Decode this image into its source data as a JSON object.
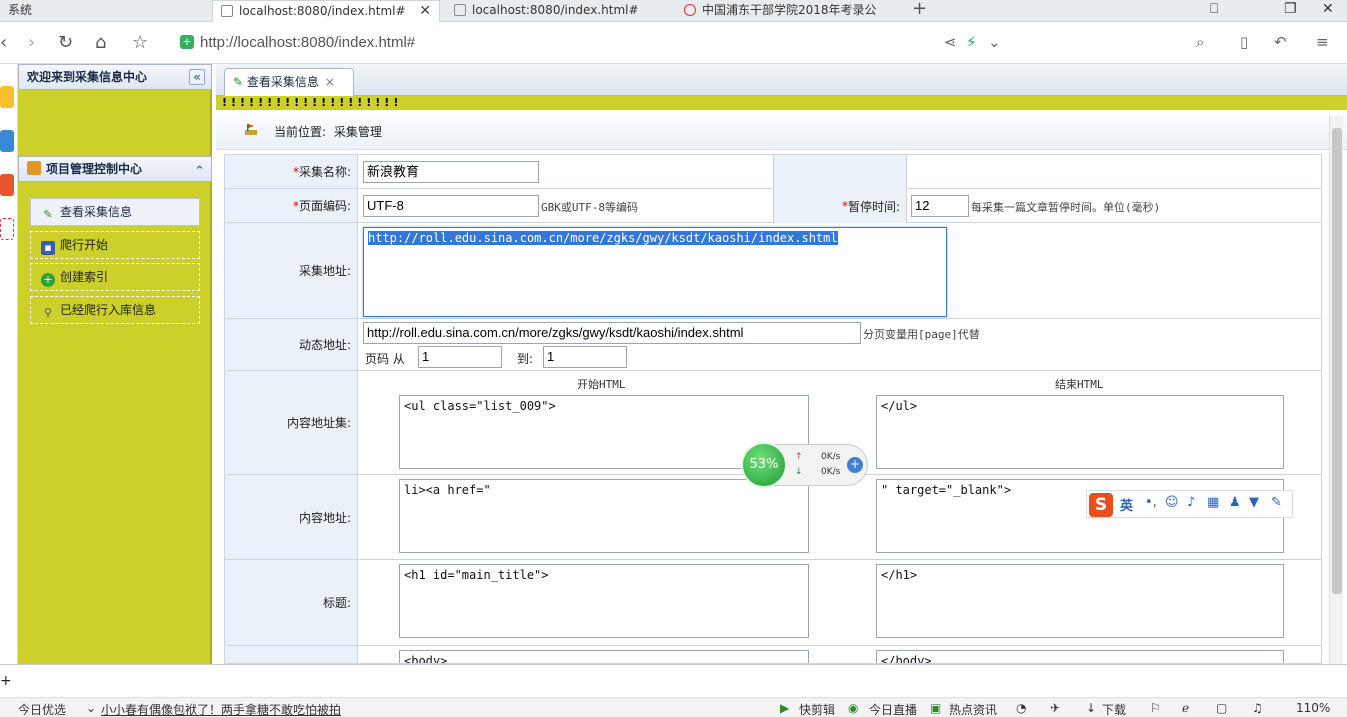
{
  "browser": {
    "tabs": [
      {
        "label": "系统",
        "active": false
      },
      {
        "label": "localhost:8080/index.html#",
        "active": true
      },
      {
        "label": "localhost:8080/index.html#",
        "active": false
      },
      {
        "label": "中国浦东干部学院2018年考录公",
        "active": false
      }
    ],
    "url": "http://localhost:8080/index.html#"
  },
  "sidebar": {
    "welcome": "欢迎来到采集信息中心",
    "section": "项目管理控制中心",
    "items": [
      {
        "label": "查看采集信息",
        "icon": "pencil-icon",
        "selected": true
      },
      {
        "label": "爬行开始",
        "icon": "save-icon",
        "selected": false
      },
      {
        "label": "创建索引",
        "icon": "plus-icon",
        "selected": false
      },
      {
        "label": "已经爬行入库信息",
        "icon": "search-icon",
        "selected": false
      }
    ]
  },
  "main": {
    "tab_label": "查看采集信息",
    "bang": "!!!!!!!!!!!!!!!!!!!!",
    "location_label": "当前位置:",
    "location_value": "采集管理"
  },
  "form": {
    "collect_name": {
      "label": "采集名称:",
      "value": "新浪教育"
    },
    "encoding": {
      "label": "页面编码:",
      "value": "UTF-8",
      "hint": "GBK或UTF-8等编码"
    },
    "pause": {
      "label": "暂停时间:",
      "value": "12",
      "hint": "每采集一篇文章暂停时间。单位(毫秒)"
    },
    "collect_url": {
      "label": "采集地址:",
      "value": "http://roll.edu.sina.com.cn/more/zgks/gwy/ksdt/kaoshi/index.shtml"
    },
    "dynamic_url": {
      "label": "动态地址:",
      "value": "http://roll.edu.sina.com.cn/more/zgks/gwy/ksdt/kaoshi/index.shtml",
      "hint": "分页变量用[page]代替"
    },
    "page_range": {
      "label_from": "页码 从",
      "from": "1",
      "label_to": "到:",
      "to": "1"
    },
    "start_html_header": "开始HTML",
    "end_html_header": "结束HTML",
    "content_url_set": {
      "label": "内容地址集:",
      "start": "<ul class=\"list_009\">",
      "end": "</ul>"
    },
    "content_url": {
      "label": "内容地址:",
      "start": "li><a href=\"",
      "end": "\" target=\"_blank\">"
    },
    "title": {
      "label": "标题:",
      "start": "<h1 id=\"main_title\">",
      "end": "</h1>"
    },
    "body": {
      "start": "<body>",
      "end": "</body>"
    }
  },
  "net_widget": {
    "percent": "53%",
    "up": "0K/s",
    "down": "0K/s"
  },
  "ime": {
    "mode": "英"
  },
  "bottom": {
    "items": [
      "今日优选",
      "小小春有偶像包袱了！两手拿糖不敢吃怕被拍",
      "快剪辑",
      "今日直播",
      "热点资讯",
      "下载",
      "110%"
    ]
  },
  "colors": {
    "accent_bar": "#cdd02a",
    "label_bg": "#eaf1f9"
  }
}
